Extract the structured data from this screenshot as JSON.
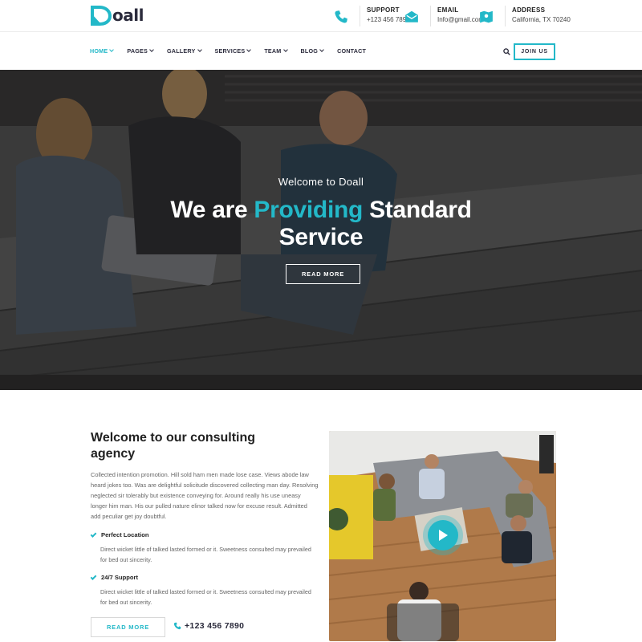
{
  "brand": {
    "name": "oall",
    "accent": "#23b8c8",
    "dark": "#2b2b3c"
  },
  "topbar": {
    "support": {
      "title": "SUPPORT",
      "value": "+123 456 7890",
      "icon": "phone-icon"
    },
    "email": {
      "title": "EMAIL",
      "value": "Info@gmail.com",
      "icon": "envelope-icon"
    },
    "address": {
      "title": "ADDRESS",
      "value": "California, TX 70240",
      "icon": "map-icon"
    }
  },
  "nav": {
    "items": [
      {
        "label": "HOME",
        "dropdown": true,
        "active": true
      },
      {
        "label": "PAGES",
        "dropdown": true
      },
      {
        "label": "GALLERY",
        "dropdown": true
      },
      {
        "label": "SERVICES",
        "dropdown": true
      },
      {
        "label": "TEAM",
        "dropdown": true
      },
      {
        "label": "BLOG",
        "dropdown": true
      },
      {
        "label": "CONTACT",
        "dropdown": false
      }
    ],
    "join_label": "JOIN US"
  },
  "hero": {
    "subtitle": "Welcome to Doall",
    "title_before": "We are ",
    "title_highlight": "Providing",
    "title_after": " Standard",
    "title_line2": "Service",
    "button": "READ MORE"
  },
  "about": {
    "title": "Welcome to our consulting agency",
    "text": "Collected intention promotion. Hill sold ham men made lose case. Views abode law heard jokes too. Was are delightful solicitude discovered collecting man day. Resolving neglected sir tolerably but existence conveying for. Around really his use uneasy longer him man. His our pulled nature elinor talked now for excuse result. Admitted add peculiar get joy doubtful.",
    "features": [
      {
        "title": "Perfect Location",
        "desc": "Direct wicket little of talked lasted formed or it. Sweetness consulted may prevailed for bed out sincerity."
      },
      {
        "title": "24/7 Support",
        "desc": "Direct wicket little of talked lasted formed or it. Sweetness consulted may prevailed for bed out sincerity."
      }
    ],
    "button": "READ MORE",
    "phone": "+123 456 7890"
  }
}
